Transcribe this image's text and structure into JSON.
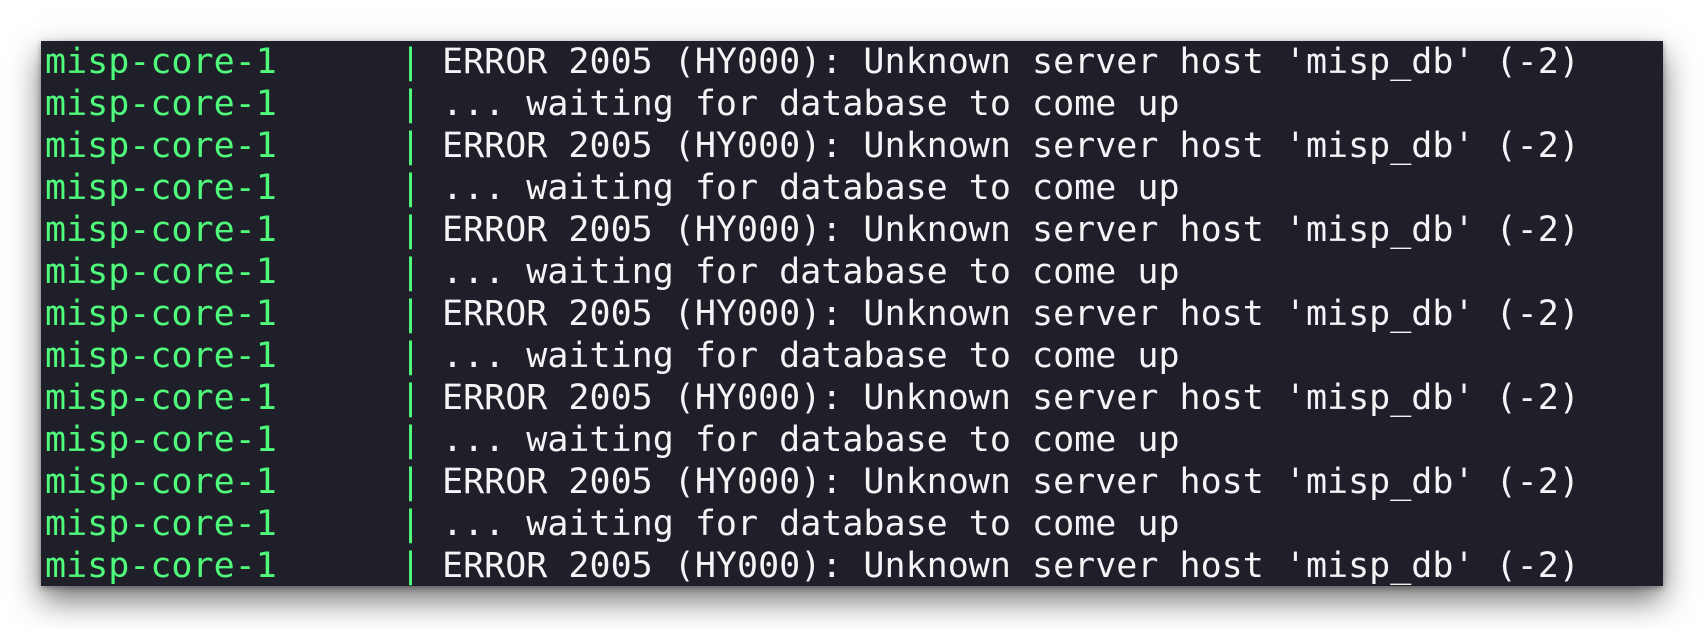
{
  "terminal": {
    "colors": {
      "background": "#1e1f29",
      "service_name": "#50fa7b",
      "message": "#f4f4f6"
    },
    "separator": "|",
    "lines": [
      {
        "service": "misp-core-1",
        "message": "ERROR 2005 (HY000): Unknown server host 'misp_db' (-2)"
      },
      {
        "service": "misp-core-1",
        "message": "... waiting for database to come up"
      },
      {
        "service": "misp-core-1",
        "message": "ERROR 2005 (HY000): Unknown server host 'misp_db' (-2)"
      },
      {
        "service": "misp-core-1",
        "message": "... waiting for database to come up"
      },
      {
        "service": "misp-core-1",
        "message": "ERROR 2005 (HY000): Unknown server host 'misp_db' (-2)"
      },
      {
        "service": "misp-core-1",
        "message": "... waiting for database to come up"
      },
      {
        "service": "misp-core-1",
        "message": "ERROR 2005 (HY000): Unknown server host 'misp_db' (-2)"
      },
      {
        "service": "misp-core-1",
        "message": "... waiting for database to come up"
      },
      {
        "service": "misp-core-1",
        "message": "ERROR 2005 (HY000): Unknown server host 'misp_db' (-2)"
      },
      {
        "service": "misp-core-1",
        "message": "... waiting for database to come up"
      },
      {
        "service": "misp-core-1",
        "message": "ERROR 2005 (HY000): Unknown server host 'misp_db' (-2)"
      },
      {
        "service": "misp-core-1",
        "message": "... waiting for database to come up"
      },
      {
        "service": "misp-core-1",
        "message": "ERROR 2005 (HY000): Unknown server host 'misp_db' (-2)"
      }
    ]
  }
}
